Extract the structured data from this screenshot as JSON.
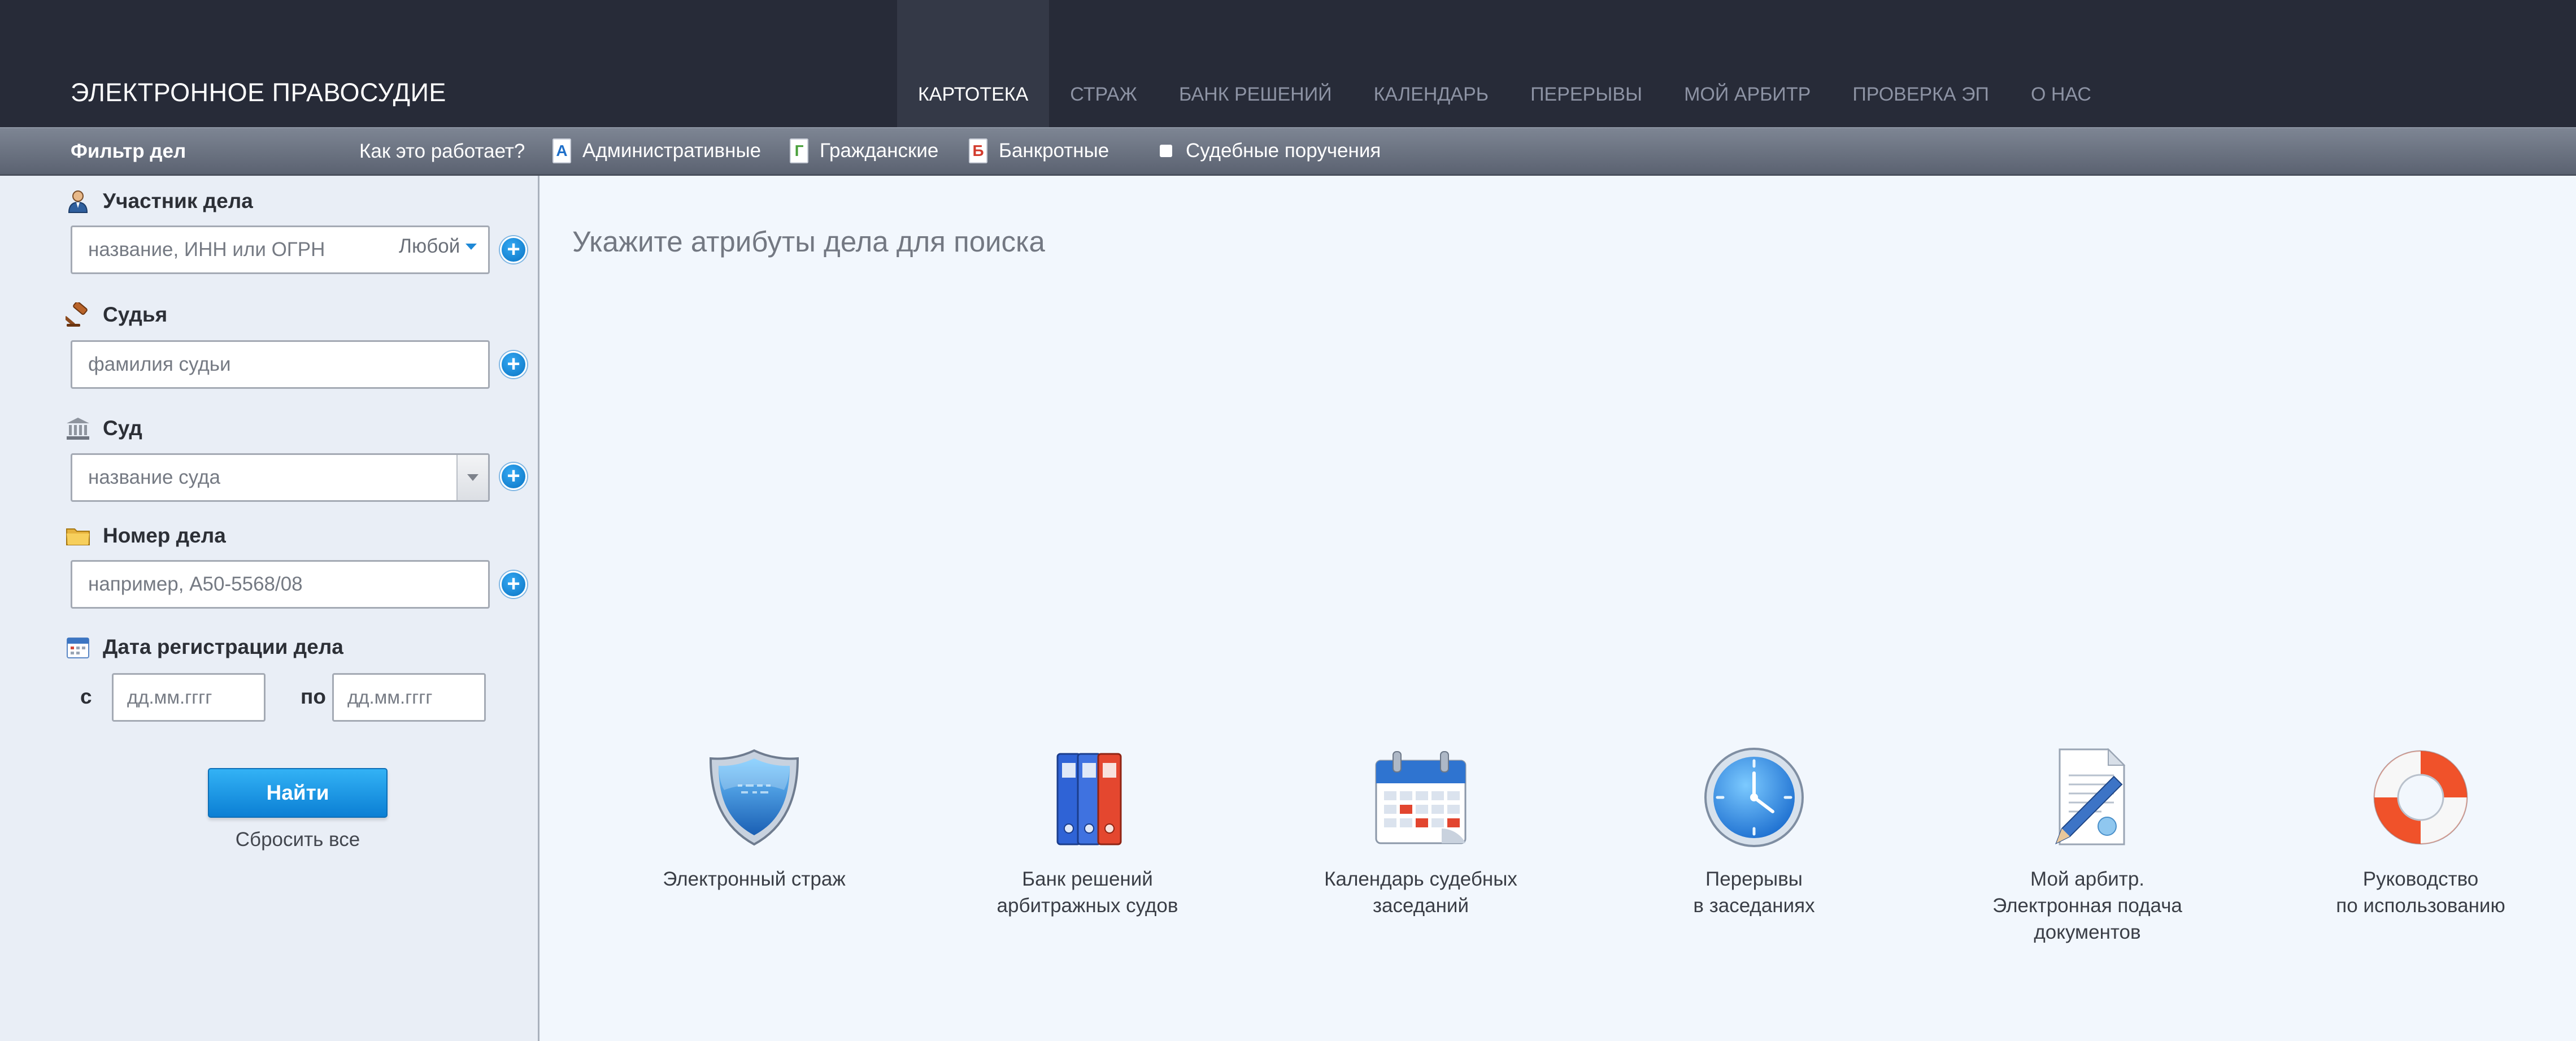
{
  "brand": "ЭЛЕКТРОННОЕ ПРАВОСУДИЕ",
  "nav": [
    {
      "label": "КАРТОТЕКА",
      "active": true
    },
    {
      "label": "СТРАЖ"
    },
    {
      "label": "БАНК РЕШЕНИЙ"
    },
    {
      "label": "КАЛЕНДАРЬ"
    },
    {
      "label": "ПЕРЕРЫВЫ"
    },
    {
      "label": "МОЙ АРБИТР"
    },
    {
      "label": "ПРОВЕРКА ЭП"
    },
    {
      "label": "О НАС"
    }
  ],
  "filterbar": {
    "title": "Фильтр дел",
    "how_link": "Как это работает?",
    "chips": [
      {
        "letter": "А",
        "label": "Административные",
        "color": "#1e6fc9"
      },
      {
        "letter": "Г",
        "label": "Гражданские",
        "color": "#4aa03b"
      },
      {
        "letter": "Б",
        "label": "Банкротные",
        "color": "#d23a2c"
      },
      {
        "label": "Судебные поручения"
      }
    ]
  },
  "sidebar": {
    "participant": {
      "label": "Участник дела",
      "placeholder": "название, ИНН или ОГРН",
      "role": "Любой"
    },
    "judge": {
      "label": "Судья",
      "placeholder": "фамилия судьи"
    },
    "court": {
      "label": "Суд",
      "placeholder": "название суда"
    },
    "case_number": {
      "label": "Номер дела",
      "placeholder": "например, А50-5568/08"
    },
    "date": {
      "label": "Дата регистрации дела",
      "from_label": "с",
      "to_label": "по",
      "placeholder": "дд.мм.гггг"
    },
    "search_button": "Найти",
    "reset_link": "Сбросить все"
  },
  "main": {
    "hint": "Укажите атрибуты дела для поиска",
    "tiles": [
      {
        "icon": "shield-icon",
        "label": "Электронный страж"
      },
      {
        "icon": "binders-icon",
        "label": "Банк решений\nарбитражных судов"
      },
      {
        "icon": "calendar-icon",
        "label": "Календарь судебных\nзаседаний"
      },
      {
        "icon": "clock-icon",
        "label": "Перерывы\nв заседаниях"
      },
      {
        "icon": "document-pen-icon",
        "label": "Мой арбитр.\nЭлектронная подача\nдокументов"
      },
      {
        "icon": "lifebuoy-icon",
        "label": "Руководство\nпо использованию"
      }
    ]
  },
  "colors": {
    "topbar": "#272b38",
    "accent": "#1e88d6",
    "sidebar": "#e9eef6",
    "main": "#f2f7fd"
  }
}
